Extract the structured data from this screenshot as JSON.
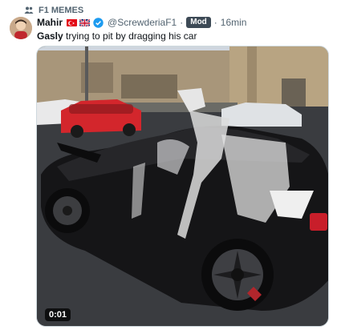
{
  "community": {
    "name": "F1 MEMES",
    "icon": "community-icon"
  },
  "tweet": {
    "author_name": "Mahir",
    "flags": [
      "turkey-flag",
      "uk-flag"
    ],
    "verified": true,
    "handle": "@ScrewderiaF1",
    "separator": "·",
    "badge": "Mod",
    "time": "16min",
    "text_mention": "Gasly",
    "text_body": " trying to pit by dragging his car"
  },
  "media": {
    "type": "video",
    "duration": "0:01"
  },
  "colors": {
    "mod_badge": "#3d4a56",
    "verified": "#1d9bf0",
    "muted_text": "#536471"
  }
}
